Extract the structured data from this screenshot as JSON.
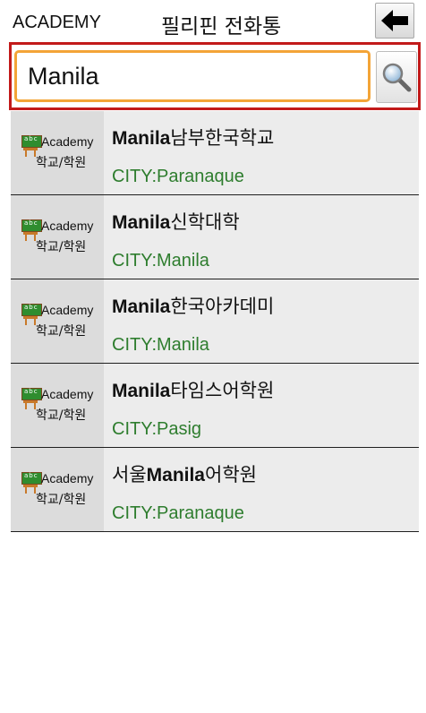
{
  "header": {
    "left_label": "ACADEMY",
    "title": "필리핀 전화통",
    "back_icon": "arrow-left-icon"
  },
  "search": {
    "value": "Manila",
    "icon": "magnifier-icon"
  },
  "thumbnail": {
    "board_text": "abc",
    "line1": "Academy",
    "line2": "학교/학원"
  },
  "results": [
    {
      "title_prefix": "",
      "title_bold": "Manila",
      "title_suffix": "남부한국학교",
      "city": "CITY:Paranaque"
    },
    {
      "title_prefix": "",
      "title_bold": "Manila",
      "title_suffix": "신학대학",
      "city": "CITY:Manila"
    },
    {
      "title_prefix": "",
      "title_bold": "Manila",
      "title_suffix": "한국아카데미",
      "city": "CITY:Manila"
    },
    {
      "title_prefix": "",
      "title_bold": "Manila",
      "title_suffix": "타임스어학원",
      "city": "CITY:Pasig"
    },
    {
      "title_prefix": "서울",
      "title_bold": "Manila",
      "title_suffix": "어학원",
      "city": "CITY:Paranaque"
    }
  ],
  "colors": {
    "highlight_border": "#c21a1a",
    "input_focus_border": "#f3a437",
    "city_text": "#2e7d2e"
  }
}
